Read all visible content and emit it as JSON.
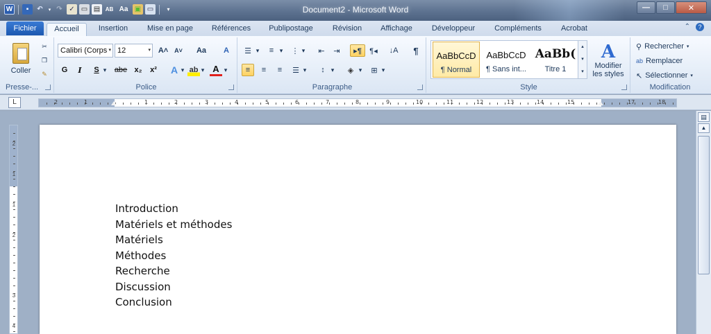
{
  "window": {
    "title": "Document2 - Microsoft Word",
    "controls": {
      "minimize": "—",
      "maximize": "□",
      "close": "✕"
    }
  },
  "qat": {
    "icons": [
      "word-logo-icon",
      "save-icon",
      "undo-icon",
      "redo-icon",
      "spellcheck-icon",
      "print-icon",
      "print-preview-icon",
      "abc-icon",
      "text-case-icon",
      "paste-icon",
      "screen-icon",
      "customize-qat-icon"
    ],
    "labels": {
      "word": "W",
      "save": "▪",
      "undo": "↶",
      "redo": "↷",
      "abc": "AB",
      "textcase": "Aa"
    }
  },
  "tabs": {
    "file": "Fichier",
    "items": [
      "Accueil",
      "Insertion",
      "Mise en page",
      "Références",
      "Publipostage",
      "Révision",
      "Affichage",
      "Développeur",
      "Compléments",
      "Acrobat"
    ],
    "active": "Accueil"
  },
  "ribbon": {
    "clipboard": {
      "paste_label": "Coller",
      "group_label": "Presse-..."
    },
    "font": {
      "font_name": "Calibri (Corps",
      "font_size": "12",
      "grow": "A˄",
      "shrink": "A˅",
      "change_case": "Aa",
      "clear": "A",
      "bold": "G",
      "italic": "I",
      "underline": "S",
      "strike": "abe",
      "subscript": "x₂",
      "superscript": "x²",
      "effects": "A",
      "highlight": "ab",
      "color": "A",
      "group_label": "Police"
    },
    "paragraph": {
      "group_label": "Paragraphe",
      "pilcrow": "¶"
    },
    "styles": {
      "items": [
        {
          "sample": "AaBbCcD",
          "name": "¶ Normal"
        },
        {
          "sample": "AaBbCcD",
          "name": "¶ Sans int..."
        },
        {
          "sample": "AaBb(",
          "name": "Titre 1"
        }
      ],
      "change_styles_line1": "Modifier",
      "change_styles_line2": "les styles",
      "group_label": "Style"
    },
    "editing": {
      "find": "Rechercher",
      "replace": "Remplacer",
      "select": "Sélectionner",
      "group_label": "Modification"
    }
  },
  "ruler": {
    "tab_selector": "L",
    "labels": [
      "2",
      "1",
      "1",
      "2",
      "3",
      "4",
      "5",
      "6",
      "7",
      "8",
      "9",
      "10",
      "11",
      "12",
      "13",
      "14",
      "15",
      "17",
      "18"
    ],
    "vlabels": [
      "2",
      "1",
      "1",
      "2",
      "3",
      "4"
    ]
  },
  "document": {
    "lines": [
      "Introduction",
      "Matériels et méthodes",
      "Matériels",
      "Méthodes",
      "Recherche",
      "Discussion",
      "Conclusion"
    ]
  },
  "colors": {
    "accent": "#1c58b0",
    "titlebar": "#5d7290",
    "ribbon": "#e3ecf7",
    "page": "#ffffff"
  }
}
